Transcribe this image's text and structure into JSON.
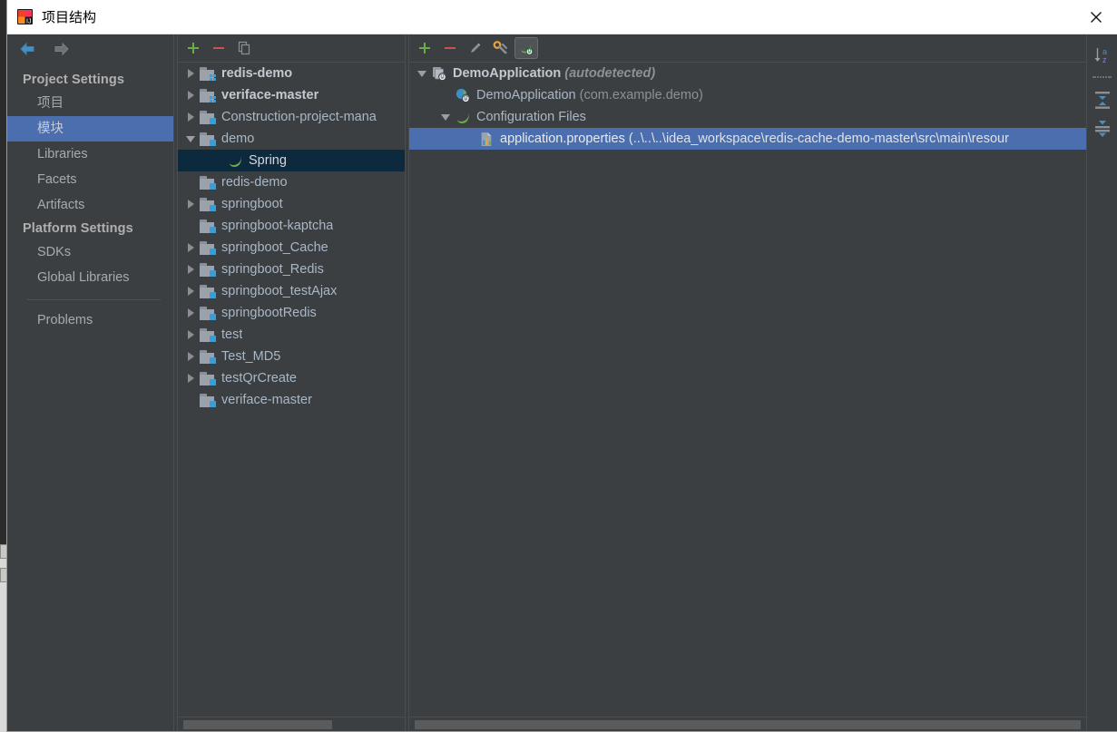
{
  "window": {
    "title": "项目结构",
    "app_icon": "intellij-idea-icon",
    "close_label": "✕"
  },
  "left_nav": {
    "back_icon": "back-arrow-icon",
    "forward_icon": "forward-arrow-icon",
    "groups": [
      {
        "label": "Project Settings",
        "items": [
          {
            "label": "项目",
            "name": "project",
            "selected": false
          },
          {
            "label": "模块",
            "name": "modules",
            "selected": true
          },
          {
            "label": "Libraries",
            "name": "libraries",
            "selected": false
          },
          {
            "label": "Facets",
            "name": "facets",
            "selected": false
          },
          {
            "label": "Artifacts",
            "name": "artifacts",
            "selected": false
          }
        ]
      },
      {
        "label": "Platform Settings",
        "items": [
          {
            "label": "SDKs",
            "name": "sdks",
            "selected": false
          },
          {
            "label": "Global Libraries",
            "name": "global-libraries",
            "selected": false
          }
        ]
      }
    ],
    "footer_items": [
      {
        "label": "Problems",
        "name": "problems",
        "selected": false
      }
    ]
  },
  "modules_panel": {
    "toolbar": [
      {
        "icon": "add-icon",
        "name": "add-module-button",
        "label": "+"
      },
      {
        "icon": "remove-icon",
        "name": "remove-module-button",
        "label": "−"
      },
      {
        "icon": "copy-icon",
        "name": "copy-module-button",
        "label": "copy"
      }
    ],
    "rows": [
      {
        "label": "redis-demo",
        "indent": 0,
        "twisty": "right",
        "icon": "module-group-folder-icon",
        "bold": true,
        "selected": "none"
      },
      {
        "label": "veriface-master",
        "indent": 0,
        "twisty": "right",
        "icon": "module-group-folder-icon",
        "bold": true,
        "selected": "none"
      },
      {
        "label": "Construction-project-mana",
        "indent": 0,
        "twisty": "right",
        "icon": "module-folder-icon",
        "bold": false,
        "selected": "none"
      },
      {
        "label": "demo",
        "indent": 0,
        "twisty": "down",
        "icon": "module-folder-icon",
        "bold": false,
        "selected": "none"
      },
      {
        "label": "Spring",
        "indent": 1,
        "twisty": "none",
        "icon": "spring-leaf-icon",
        "bold": false,
        "selected": "dark"
      },
      {
        "label": "redis-demo",
        "indent": 0,
        "twisty": "none",
        "icon": "module-folder-icon",
        "bold": false,
        "selected": "none"
      },
      {
        "label": "springboot",
        "indent": 0,
        "twisty": "right",
        "icon": "module-folder-icon",
        "bold": false,
        "selected": "none"
      },
      {
        "label": "springboot-kaptcha",
        "indent": 0,
        "twisty": "none",
        "icon": "module-folder-icon",
        "bold": false,
        "selected": "none"
      },
      {
        "label": "springboot_Cache",
        "indent": 0,
        "twisty": "right",
        "icon": "module-folder-icon",
        "bold": false,
        "selected": "none"
      },
      {
        "label": "springboot_Redis",
        "indent": 0,
        "twisty": "right",
        "icon": "module-folder-icon",
        "bold": false,
        "selected": "none"
      },
      {
        "label": "springboot_testAjax",
        "indent": 0,
        "twisty": "right",
        "icon": "module-folder-icon",
        "bold": false,
        "selected": "none"
      },
      {
        "label": "springbootRedis",
        "indent": 0,
        "twisty": "right",
        "icon": "module-folder-icon",
        "bold": false,
        "selected": "none"
      },
      {
        "label": "test",
        "indent": 0,
        "twisty": "right",
        "icon": "module-folder-icon",
        "bold": false,
        "selected": "none"
      },
      {
        "label": "Test_MD5",
        "indent": 0,
        "twisty": "right",
        "icon": "module-folder-icon",
        "bold": false,
        "selected": "none"
      },
      {
        "label": "testQrCreate",
        "indent": 0,
        "twisty": "right",
        "icon": "module-folder-icon",
        "bold": false,
        "selected": "none"
      },
      {
        "label": "veriface-master",
        "indent": 0,
        "twisty": "none",
        "icon": "module-folder-icon",
        "bold": false,
        "selected": "none"
      }
    ]
  },
  "detail_panel": {
    "toolbar": [
      {
        "icon": "add-icon",
        "name": "add-facet-button",
        "label": "+"
      },
      {
        "icon": "remove-icon",
        "name": "remove-facet-button",
        "label": "−"
      },
      {
        "icon": "edit-icon",
        "name": "edit-facet-button",
        "label": "edit"
      },
      {
        "icon": "wrench-icon",
        "name": "configure-facet-button",
        "label": "configure"
      },
      {
        "icon": "spring-icon",
        "name": "spring-facet-button",
        "label": "spring",
        "active": true
      }
    ],
    "rows": [
      {
        "label": "DemoApplication",
        "suffix": " (autodetected)",
        "suffix_style": "italic",
        "indent": 0,
        "twisty": "down",
        "icon": "spring-context-icon",
        "bold": true,
        "selected": "none"
      },
      {
        "label": "DemoApplication",
        "suffix": " (com.example.demo)",
        "suffix_style": "muted",
        "indent": 1,
        "twisty": "none",
        "icon": "spring-bean-icon",
        "bold": false,
        "selected": "none"
      },
      {
        "label": "Configuration Files",
        "suffix": "",
        "suffix_style": "none",
        "indent": 1,
        "twisty": "down",
        "icon": "spring-leaf-icon",
        "bold": false,
        "selected": "none"
      },
      {
        "label": "application.properties",
        "suffix": " (..\\..\\..\\idea_workspace\\redis-cache-demo-master\\src\\main\\resour",
        "suffix_style": "muted",
        "indent": 2,
        "twisty": "none",
        "icon": "properties-file-icon",
        "bold": false,
        "selected": "blue"
      }
    ]
  },
  "right_rail": {
    "buttons": [
      {
        "icon": "sort-alphabetically-icon",
        "name": "sort-az-button"
      },
      {
        "icon": "expand-all-icon",
        "name": "expand-all-button"
      },
      {
        "icon": "collapse-all-icon",
        "name": "collapse-all-button"
      }
    ]
  },
  "colors": {
    "background": "#3c3f41",
    "selection_blue": "#4b6eaf",
    "selection_inactive": "#0d293e",
    "text": "#a9b7c6",
    "accent_green": "#6cab4a",
    "accent_red": "#c75450",
    "accent_blue": "#389fd6"
  }
}
